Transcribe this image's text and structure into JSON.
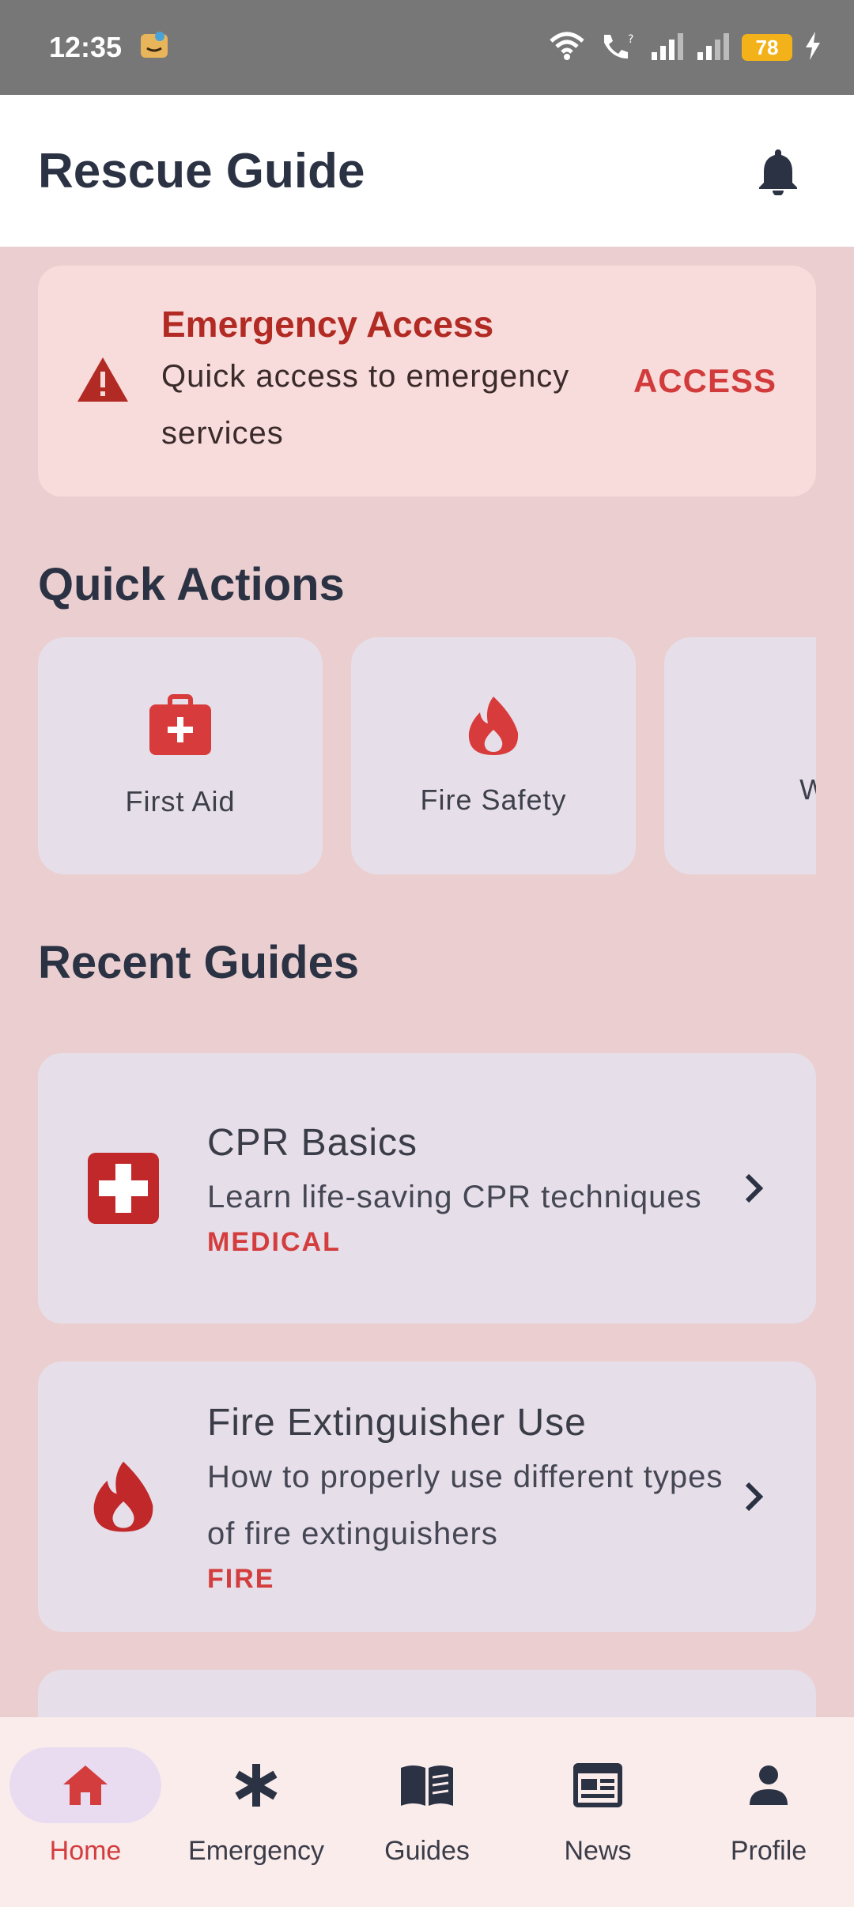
{
  "status_bar": {
    "time": "12:35",
    "battery": "78",
    "icons": [
      "amazon-app-icon",
      "wifi-icon",
      "call-icon",
      "signal-icon",
      "signal-icon",
      "battery-icon",
      "charging-icon"
    ]
  },
  "app_bar": {
    "title": "Rescue Guide",
    "action_icon": "bell-icon"
  },
  "emergency": {
    "title": "Emergency Access",
    "description": "Quick access to emergency services",
    "button": "ACCESS",
    "icon": "warning-icon"
  },
  "quick_actions": {
    "heading": "Quick Actions",
    "items": [
      {
        "label": "First Aid",
        "icon": "first-aid-kit-icon"
      },
      {
        "label": "Fire Safety",
        "icon": "fire-icon"
      },
      {
        "label": "Water R",
        "icon": "water-waves-icon"
      }
    ]
  },
  "recent_guides": {
    "heading": "Recent Guides",
    "items": [
      {
        "title": "CPR Basics",
        "description": "Learn life-saving CPR techniques",
        "category": "MEDICAL",
        "icon": "medical-cross-icon"
      },
      {
        "title": "Fire Extinguisher Use",
        "description": "How to properly use different types of fire extinguishers",
        "category": "FIRE",
        "icon": "fire-icon"
      }
    ]
  },
  "bottom_nav": {
    "items": [
      {
        "label": "Home",
        "icon": "home-icon",
        "active": true
      },
      {
        "label": "Emergency",
        "icon": "asterisk-icon",
        "active": false
      },
      {
        "label": "Guides",
        "icon": "book-icon",
        "active": false
      },
      {
        "label": "News",
        "icon": "newspaper-icon",
        "active": false
      },
      {
        "label": "Profile",
        "icon": "person-icon",
        "active": false
      }
    ]
  },
  "colors": {
    "accent": "#d43d3d",
    "dark_red": "#b22a24",
    "background": "#ebcfd0",
    "card": "#e6dee8"
  }
}
